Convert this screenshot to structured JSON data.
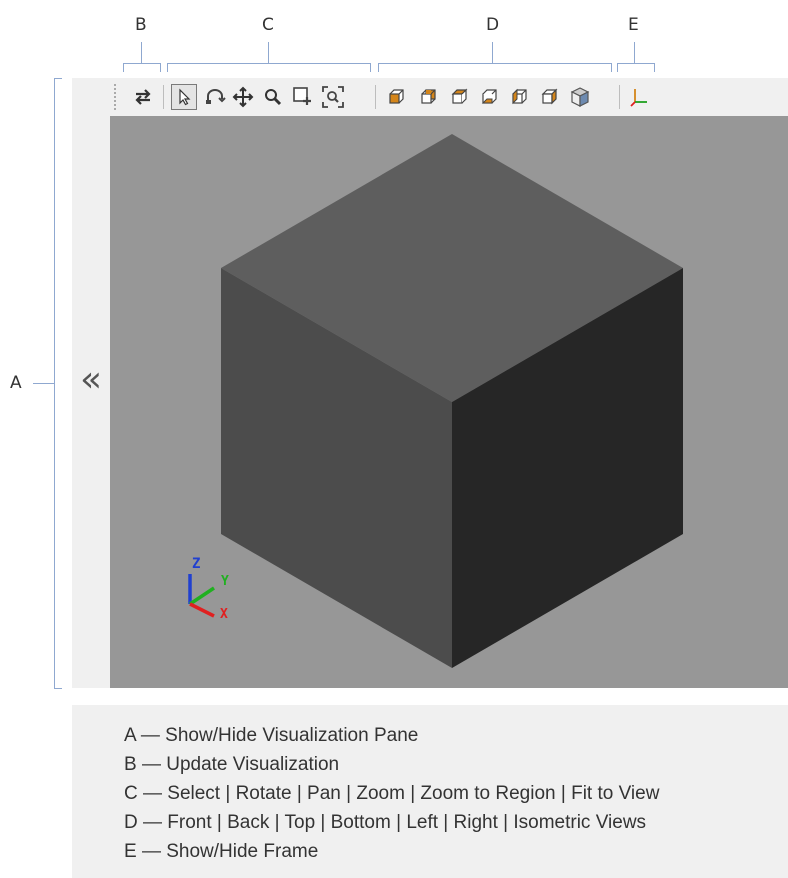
{
  "callouts": {
    "A": "A",
    "B": "B",
    "C": "C",
    "D": "D",
    "E": "E"
  },
  "visualization_pane": {
    "collapse_glyph": "«",
    "collapse_icon": "double-chevron-left-icon"
  },
  "toolbar": {
    "update_icon": "swap-arrows-icon",
    "interaction_tools": [
      "select-arrow-icon",
      "rotate-icon",
      "pan-icon",
      "zoom-icon",
      "zoom-to-region-icon",
      "fit-to-view-icon"
    ],
    "view_tools": [
      "front-view-icon",
      "back-view-icon",
      "top-view-icon",
      "bottom-view-icon",
      "left-view-icon",
      "right-view-icon",
      "isometric-view-icon"
    ],
    "frame_icon": "axes-frame-icon",
    "selected_tool": "select-arrow-icon",
    "accent_color": "#d4851a"
  },
  "axes_triad": {
    "x_label": "X",
    "y_label": "Y",
    "z_label": "Z",
    "x_color": "#e02020",
    "y_color": "#20b020",
    "z_color": "#2040d0"
  },
  "legend": {
    "line_a": "A — Show/Hide Visualization Pane",
    "line_b": "B — Update Visualization",
    "line_c": "C — Select | Rotate | Pan | Zoom | Zoom to Region | Fit to View",
    "line_d": "D — Front | Back | Top | Bottom | Left | Right | Isometric Views",
    "line_e": "E — Show/Hide Frame"
  },
  "colors": {
    "viewport_bg": "#979797",
    "cube_top": "#5e5e5e",
    "cube_left": "#4c4c4c",
    "cube_right": "#262626",
    "bracket": "#8fa8d0"
  }
}
